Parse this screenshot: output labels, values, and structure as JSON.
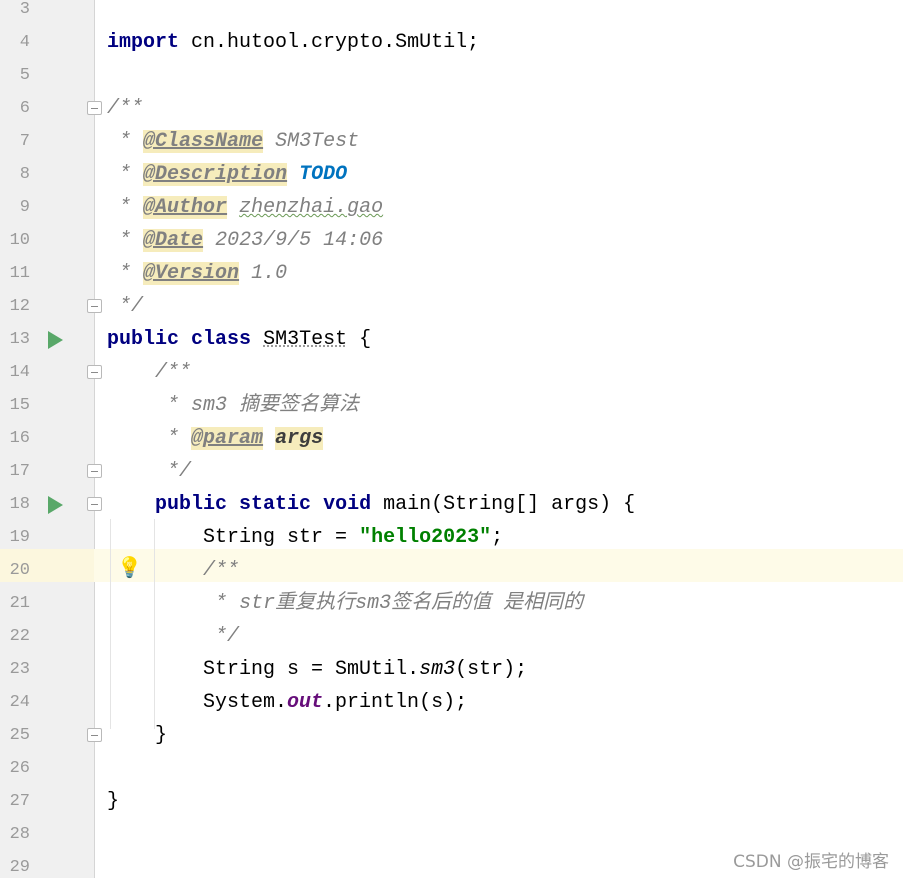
{
  "editor": {
    "highlighted_line": 20,
    "lines": [
      {
        "n": "3",
        "code": ""
      },
      {
        "n": "4",
        "code": "import cn.hutool.crypto.SmUtil;"
      },
      {
        "n": "5",
        "code": ""
      },
      {
        "n": "6",
        "code": "/**"
      },
      {
        "n": "7",
        "code": " * @ClassName SM3Test"
      },
      {
        "n": "8",
        "code": " * @Description TODO"
      },
      {
        "n": "9",
        "code": " * @Author zhenzhai.gao"
      },
      {
        "n": "10",
        "code": " * @Date 2023/9/5 14:06"
      },
      {
        "n": "11",
        "code": " * @Version 1.0"
      },
      {
        "n": "12",
        "code": " */"
      },
      {
        "n": "13",
        "code": "public class SM3Test {"
      },
      {
        "n": "14",
        "code": "    /**"
      },
      {
        "n": "15",
        "code": "     * sm3 摘要签名算法"
      },
      {
        "n": "16",
        "code": "     * @param args"
      },
      {
        "n": "17",
        "code": "     */"
      },
      {
        "n": "18",
        "code": "    public static void main(String[] args) {"
      },
      {
        "n": "19",
        "code": "        String str = \"hello2023\";"
      },
      {
        "n": "20",
        "code": "        /**"
      },
      {
        "n": "21",
        "code": "         * str重复执行sm3签名后的值 是相同的"
      },
      {
        "n": "22",
        "code": "         */"
      },
      {
        "n": "23",
        "code": "        String s = SmUtil.sm3(str);"
      },
      {
        "n": "24",
        "code": "        System.out.println(s);"
      },
      {
        "n": "25",
        "code": "    }"
      },
      {
        "n": "26",
        "code": ""
      },
      {
        "n": "27",
        "code": "}"
      },
      {
        "n": "28",
        "code": ""
      },
      {
        "n": "29",
        "code": ""
      }
    ]
  },
  "tokens": {
    "import_kw": "import",
    "import_path": "cn.hutool.crypto.SmUtil;",
    "doc_open": "/**",
    "star": "*",
    "classname_tag": "@ClassName",
    "classname_val": "SM3Test",
    "description_tag": "@Description",
    "description_val": "TODO",
    "author_tag": "@Author",
    "author_val": "zhenzhai.gao",
    "date_tag": "@Date",
    "date_val": "2023/9/5 14:06",
    "version_tag": "@Version",
    "version_val": "1.0",
    "doc_close": "*/",
    "public_kw": "public",
    "class_kw": "class",
    "class_name": "SM3Test",
    "open_brace": "{",
    "close_brace": "}",
    "method_doc_text": "sm3 摘要签名算法",
    "param_tag": "@param",
    "param_name": "args",
    "static_kw": "static",
    "void_kw": "void",
    "method_sig": "main(String[] args)",
    "type_string": "String",
    "var_str": "str =",
    "str_literal": "\"hello2023\"",
    "semicolon": ";",
    "inline_doc_text": "str重复执行sm3签名后的值 是相同的",
    "var_s": "s = SmUtil.",
    "sm3_call": "sm3",
    "sm3_args": "(str);",
    "system": "System.",
    "out_field": "out",
    "println_call": ".println(s);"
  },
  "icons": {
    "run": "run-gutter-icon",
    "fold": "fold-icon",
    "bulb": "lightbulb-icon"
  },
  "colors": {
    "keyword": "#000080",
    "string": "#008000",
    "comment": "#808080",
    "todo": "#0073bf",
    "field": "#660e7a",
    "highlight_line": "#fefbe8"
  },
  "watermark": "CSDN @振宅的博客"
}
